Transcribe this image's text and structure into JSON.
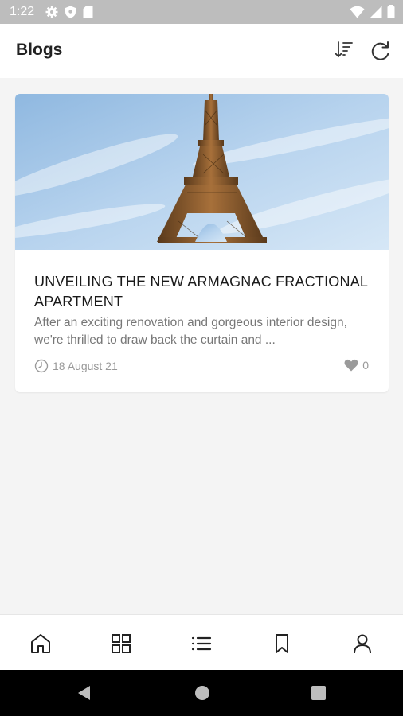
{
  "status_bar": {
    "time": "1:22",
    "left_icons": [
      "settings-icon",
      "shield-icon",
      "sd-card-icon"
    ],
    "right_icons": [
      "wifi-icon",
      "cell-signal-icon",
      "battery-icon"
    ]
  },
  "app_bar": {
    "title": "Blogs",
    "actions": [
      "sort-icon",
      "refresh-icon"
    ]
  },
  "posts": [
    {
      "image": "eiffel-tower-image",
      "title": "UNVEILING THE NEW ARMAGNAC FRACTIONAL APARTMENT",
      "excerpt": "After an exciting renovation and gorgeous interior design, we're thrilled to draw back the curtain and ...",
      "date": "18 August 21",
      "likes": "0"
    }
  ],
  "bottom_nav": [
    "home-icon",
    "grid-icon",
    "list-icon",
    "bookmark-icon",
    "profile-icon"
  ],
  "colors": {
    "status_bar": "#bdbdbd",
    "background": "#f4f4f4",
    "title_text": "#222222",
    "meta_text": "#999999"
  }
}
